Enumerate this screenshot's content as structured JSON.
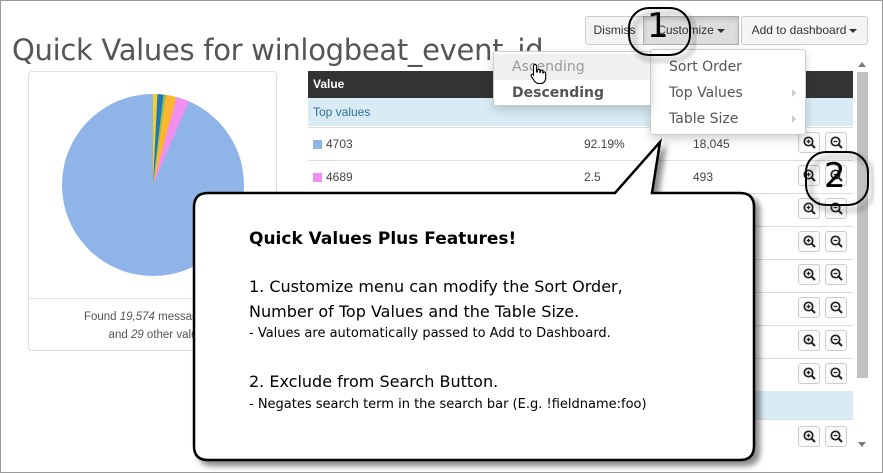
{
  "header": {
    "title": "Quick Values for winlogbeat_event_id",
    "dismiss_label": "Dismiss",
    "customize_label": "Customize",
    "add_to_dashboard_label": "Add to dashboard"
  },
  "pie_card": {
    "found_prefix": "Found ",
    "found_count": "19,574",
    "found_mid": " messages w",
    "found_line2_prefix": "and ",
    "found_other_count": "29",
    "found_line2_suffix": " other valu"
  },
  "table": {
    "header_value": "Value",
    "section_top_values": "Top values",
    "rows": [
      {
        "value": "4703",
        "percent": "92.19%",
        "count": "18,045",
        "color": "#8fb4e8"
      },
      {
        "value": "4689",
        "percent": "2.5",
        "count": "493",
        "color": "#f08ff0"
      }
    ]
  },
  "customize_menu": {
    "items": [
      "Sort Order",
      "Top Values",
      "Table Size"
    ]
  },
  "sort_submenu": {
    "items": [
      "Ascending",
      "Descending"
    ]
  },
  "callout": {
    "title": "Quick Values Plus Features!",
    "p1_line1": "1. Customize menu can modify the Sort Order,",
    "p1_line2": "Number of Top Values and the Table Size.",
    "p1_note": "- Values are automatically passed to Add to Dashboard.",
    "p2_line1": "2. Exclude from Search Button.",
    "p2_note": "- Negates search term in the search bar (E.g. !fieldname:foo)"
  },
  "badges": {
    "one": "1",
    "two": "2"
  },
  "colors": {
    "pie_main": "#8fb4e8",
    "slice_pink": "#f08ff0",
    "slice_orange": "#ffb62e",
    "slice_blue": "#1f77b4",
    "slice_green": "#8bc34a",
    "slice_yellow": "#f2d02b",
    "section_bg": "#d9ecf5",
    "header_bg": "#333333"
  },
  "icons": {
    "zoom_in": "search-plus-icon",
    "zoom_out": "search-minus-icon",
    "cursor": "hand-pointer-icon"
  }
}
